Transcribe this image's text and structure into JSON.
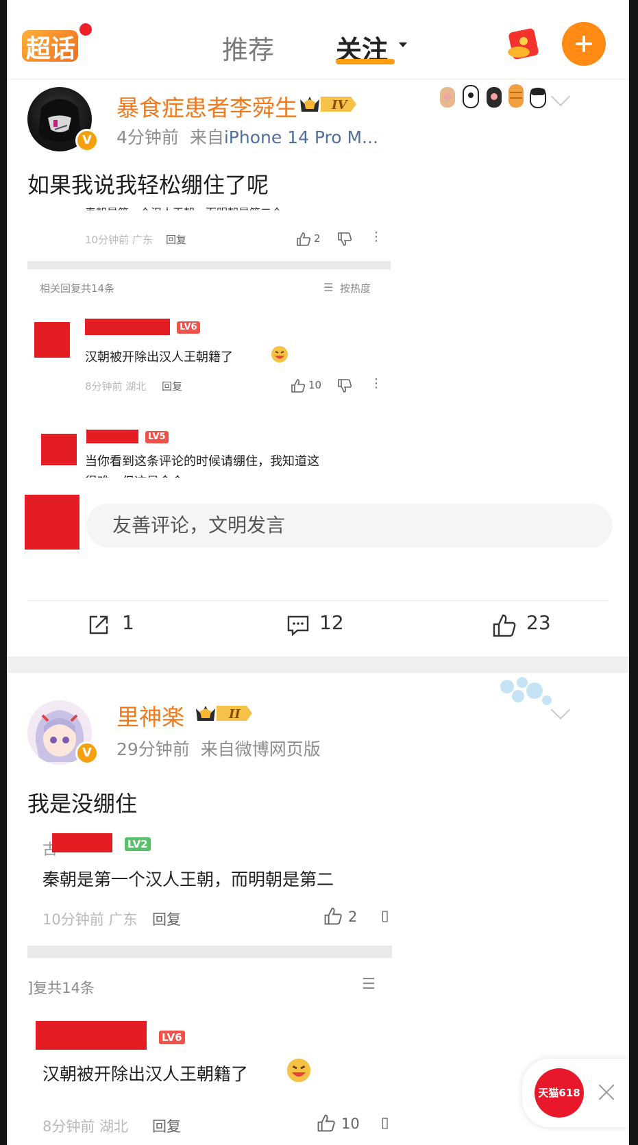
{
  "header": {
    "logo_text": "超话",
    "tab_recommend": "推荐",
    "tab_follow": "关注"
  },
  "post1": {
    "username": "暴食症患者李舜生",
    "level_badge": "IV",
    "time": "4分钟前",
    "source_prefix": "来自",
    "source": "iPhone 14 Pro M...",
    "text": "如果我说我轻松绷住了呢",
    "embed": {
      "top_cut_text": "秦朝是第一个汉人王朝，而明朝是第二个",
      "top_meta": "10分钟前 广东",
      "top_reply": "回复",
      "top_likes": "2",
      "replies_summary": "相关回复共14条",
      "sort_label": "按热度",
      "c1_level": "LV6",
      "c1_text": "汉朝被开除出汉人王朝籍了",
      "c1_meta": "8分钟前 湖北",
      "c1_reply": "回复",
      "c1_likes": "10",
      "c2_level": "LV5",
      "c2_text": "当你看到这条评论的时候请绷住，我知道这",
      "c2_text_cut": "很难，但这是命令"
    },
    "comment_placeholder": "友善评论，文明发言",
    "actions": {
      "share": "1",
      "comments": "12",
      "likes": "23"
    }
  },
  "post2": {
    "username": "里神楽",
    "level_badge": "II",
    "time": "29分钟前",
    "source": "来自微博网页版",
    "text": "我是没绷住",
    "embed": {
      "c0_level": "LV2",
      "c0_text": "秦朝是第一个汉人王朝，而明朝是第二",
      "c0_meta": "10分钟前 广东",
      "c0_reply": "回复",
      "c0_likes": "2",
      "replies_summary": "]复共14条",
      "c1_level": "LV6",
      "c1_text": "汉朝被开除出汉人王朝籍了",
      "c1_meta": "8分钟前 湖北",
      "c1_reply": "回复",
      "c1_likes": "10"
    }
  },
  "float_ad": {
    "label": "天猫618"
  },
  "colors": {
    "accent": "#ff8a14",
    "username": "#ef7a1d",
    "redact": "#e41c23"
  }
}
